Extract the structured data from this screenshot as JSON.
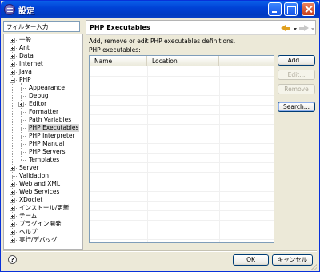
{
  "window": {
    "title": "設定"
  },
  "filter": {
    "value": "フィルター入力"
  },
  "tree": {
    "items": [
      {
        "label": "一般",
        "expander": "plus"
      },
      {
        "label": "Ant",
        "expander": "plus"
      },
      {
        "label": "Data",
        "expander": "plus"
      },
      {
        "label": "Internet",
        "expander": "plus"
      },
      {
        "label": "Java",
        "expander": "plus"
      },
      {
        "label": "PHP",
        "expander": "minus"
      },
      {
        "label": "Appearance"
      },
      {
        "label": "Debug"
      },
      {
        "label": "Editor",
        "expander": "plus"
      },
      {
        "label": "Formatter"
      },
      {
        "label": "Path Variables"
      },
      {
        "label": "PHP Executables",
        "selected": true
      },
      {
        "label": "PHP Interpreter"
      },
      {
        "label": "PHP Manual"
      },
      {
        "label": "PHP Servers"
      },
      {
        "label": "Templates"
      },
      {
        "label": "Server",
        "expander": "plus"
      },
      {
        "label": "Validation"
      },
      {
        "label": "Web and XML",
        "expander": "plus"
      },
      {
        "label": "Web Services",
        "expander": "plus"
      },
      {
        "label": "XDoclet",
        "expander": "plus"
      },
      {
        "label": "インストール/更新",
        "expander": "plus"
      },
      {
        "label": "チーム",
        "expander": "plus"
      },
      {
        "label": "プラグイン開発",
        "expander": "plus"
      },
      {
        "label": "ヘルプ",
        "expander": "plus"
      },
      {
        "label": "実行/デバッグ",
        "expander": "plus"
      }
    ]
  },
  "page": {
    "title": "PHP Executables",
    "description": "Add, remove or edit PHP executables definitions.",
    "table_label": "PHP executables:",
    "columns": [
      "Name",
      "Location"
    ]
  },
  "buttons": {
    "add": "Add...",
    "edit": "Edit...",
    "remove": "Remove",
    "search": "Search...",
    "ok": "OK",
    "cancel": "キャンセル"
  },
  "help": {
    "glyph": "?"
  },
  "colors": {
    "titlebar": "#0042d6",
    "dialog_bg": "#ece9d8",
    "selection": "#d6d6d6",
    "nav_arrow": "#e0a020"
  },
  "icons": {
    "window": "eclipse-icon",
    "back": "back-arrow-icon",
    "forward": "forward-arrow-icon",
    "help": "help-icon"
  }
}
